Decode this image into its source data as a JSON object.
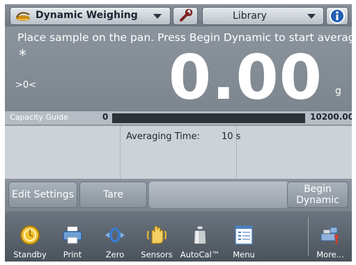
{
  "topbar": {
    "application_label": "Dynamic Weighing",
    "library_label": "Library"
  },
  "display": {
    "instruction": "Place sample on the pan.  Press Begin Dynamic to start averaging.",
    "stable_indicator": "*",
    "zero_indicator": ">0<",
    "weight_value": "0.00",
    "unit": "g"
  },
  "capacity_guide": {
    "label": "Capacity Guide",
    "min": "0",
    "max": "10200.00",
    "fill_fraction": 0
  },
  "info_panel": {
    "averaging_time_label": "Averaging Time:",
    "averaging_time_value": "10 s"
  },
  "actions": {
    "edit_settings": "Edit Settings",
    "tare": "Tare",
    "begin_dynamic_line1": "Begin",
    "begin_dynamic_line2": "Dynamic"
  },
  "nav": {
    "items": [
      {
        "label": "Standby",
        "icon": "standby-icon"
      },
      {
        "label": "Print",
        "icon": "printer-icon"
      },
      {
        "label": "Zero",
        "icon": "zero-icon"
      },
      {
        "label": "Sensors",
        "icon": "hand-sensor-icon"
      },
      {
        "label": "AutoCal™",
        "icon": "calibration-weight-icon"
      },
      {
        "label": "Menu",
        "icon": "menu-icon"
      },
      {
        "label": "More...",
        "icon": "more-icon"
      }
    ]
  },
  "colors": {
    "screen_bg": "#8d96a0",
    "button_face": "#b9c0c7",
    "info_blue": "#1f5fb4",
    "capacity_bar": "#2e3338"
  }
}
